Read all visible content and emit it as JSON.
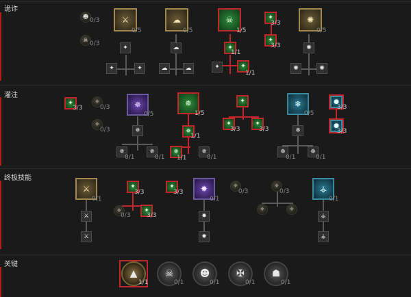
{
  "sections": {
    "s1": {
      "label": "诡诈"
    },
    "s2": {
      "label": "灌注"
    },
    "s3": {
      "label": "终极技能"
    },
    "s4": {
      "label": "关键"
    }
  },
  "ranks": {
    "r0_3": "0/3",
    "r3_3": "3/3",
    "r0_5": "0/5",
    "r1_5": "1/5",
    "r1_1": "1/1",
    "r0_1": "0/1"
  },
  "colors": {
    "accent_red": "#c0272d",
    "bg": "#1a1a1a"
  }
}
